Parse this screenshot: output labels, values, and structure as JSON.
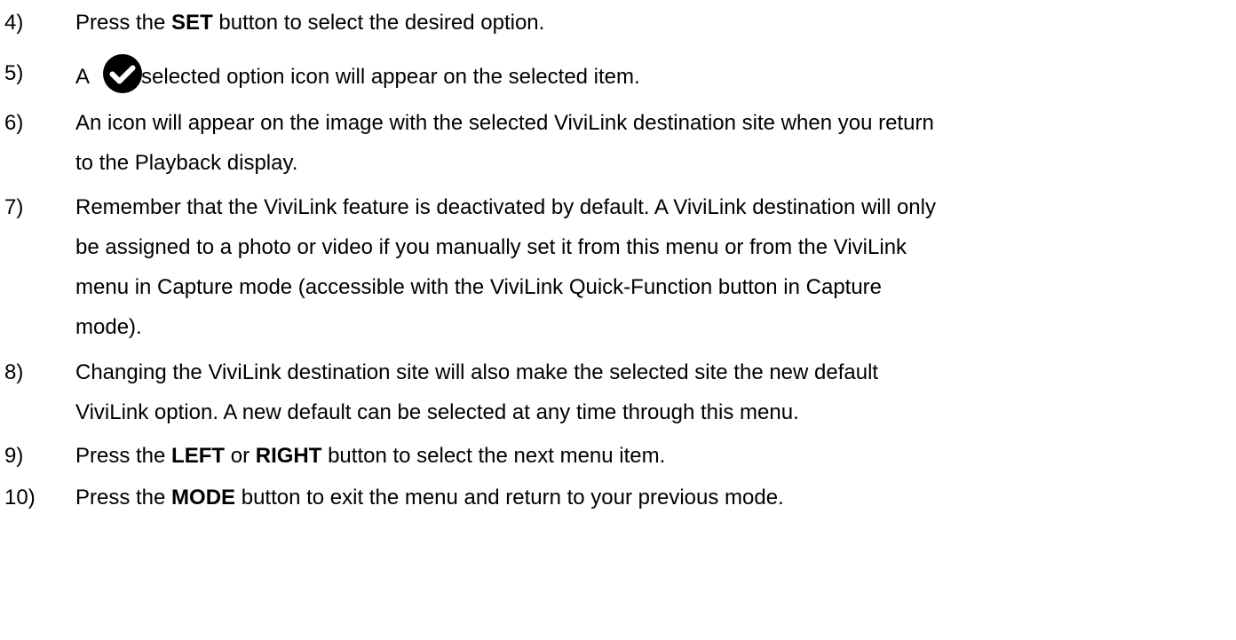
{
  "steps": [
    {
      "number": "4)",
      "parts": [
        "Press the ",
        "SET",
        " button to select the desired option."
      ]
    },
    {
      "number": "5)",
      "parts": [
        "A",
        "selected option icon will appear on the selected item."
      ],
      "icon": "check-circle-icon"
    },
    {
      "number": "6)",
      "lines": [
        "An icon will appear on the image with the selected ViviLink destination site when you return",
        "to the Playback display."
      ]
    },
    {
      "number": "7)",
      "lines": [
        "Remember that the ViviLink feature is deactivated by default. A ViviLink destination will only",
        "be assigned to a photo or video if you manually set it from this menu or from the ViviLink",
        "menu in Capture mode (accessible with the ViviLink Quick-Function button in Capture",
        "mode)."
      ]
    },
    {
      "number": "8)",
      "lines": [
        "Changing the ViviLink destination site will also make the selected site the new default",
        "ViviLink option. A new default can be selected at any time through this menu."
      ]
    },
    {
      "number": "9)",
      "parts": [
        "Press the ",
        "LEFT",
        " or ",
        "RIGHT",
        " button to select the next menu item."
      ]
    },
    {
      "number": "10)",
      "parts": [
        "Press the ",
        "MODE",
        " button to exit the menu and return to your previous mode."
      ]
    }
  ]
}
